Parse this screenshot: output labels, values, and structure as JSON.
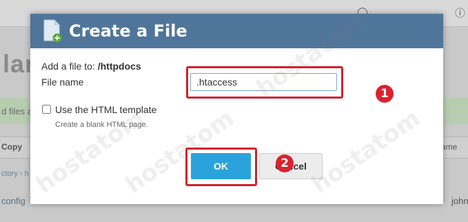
{
  "background": {
    "heading": "lan",
    "banner_text": "d files a",
    "toolbar_copy": "Copy",
    "name_column": "ame",
    "breadcrumb": "ctory › h",
    "row_name": "config",
    "row_owner": "john"
  },
  "dialog": {
    "title": "Create a File",
    "target_prefix": "Add a file to: ",
    "target_path": "/httpdocs",
    "filename_label": "File name",
    "filename_value": ".htaccess",
    "template_checkbox_label": "Use the HTML template",
    "template_checked": false,
    "template_hint": "Create a blank HTML page.",
    "ok_label": "OK",
    "cancel_label": "Cancel"
  },
  "annotations": {
    "step1": "1",
    "step2": "2",
    "marker_color": "#d9232e"
  },
  "watermark": "hostatom",
  "icons": {
    "file": "new-file-icon",
    "user": "user-icon",
    "help": "help-icon"
  },
  "colors": {
    "header": "#50759a",
    "ok_button": "#2aa3dc",
    "highlight": "#d0202c"
  }
}
